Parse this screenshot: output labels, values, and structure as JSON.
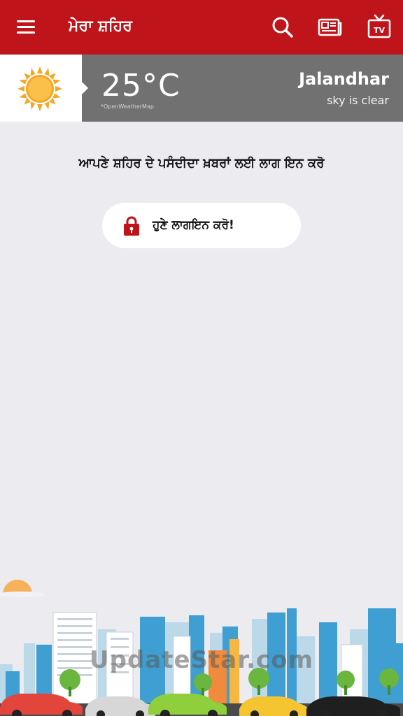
{
  "appbar": {
    "title": "ਮੇਰਾ ਸ਼ਹਿਰ",
    "color": "#c0141b",
    "icons": [
      "menu-icon",
      "search-icon",
      "newspaper-icon",
      "tv-icon"
    ]
  },
  "weather": {
    "temperature": "25°C",
    "provider": "*OpenWeatherMap",
    "city": "Jalandhar",
    "condition": "sky is clear",
    "icon": "sun-icon"
  },
  "main": {
    "prompt": "ਆਪਣੇ ਸ਼ਹਿਰ ਦੇ ਪਸੰਦੀਦਾ ਖ਼ਬਰਾਂ ਲਈ ਲਾਗ ਇਨ ਕਰੋ",
    "login_button": {
      "label": "ਹੁਣੇ ਲਾਗਇਨ ਕਰੋ!",
      "icon": "lock-icon"
    }
  },
  "footer": {
    "watermark": "UpdateStar.com"
  }
}
